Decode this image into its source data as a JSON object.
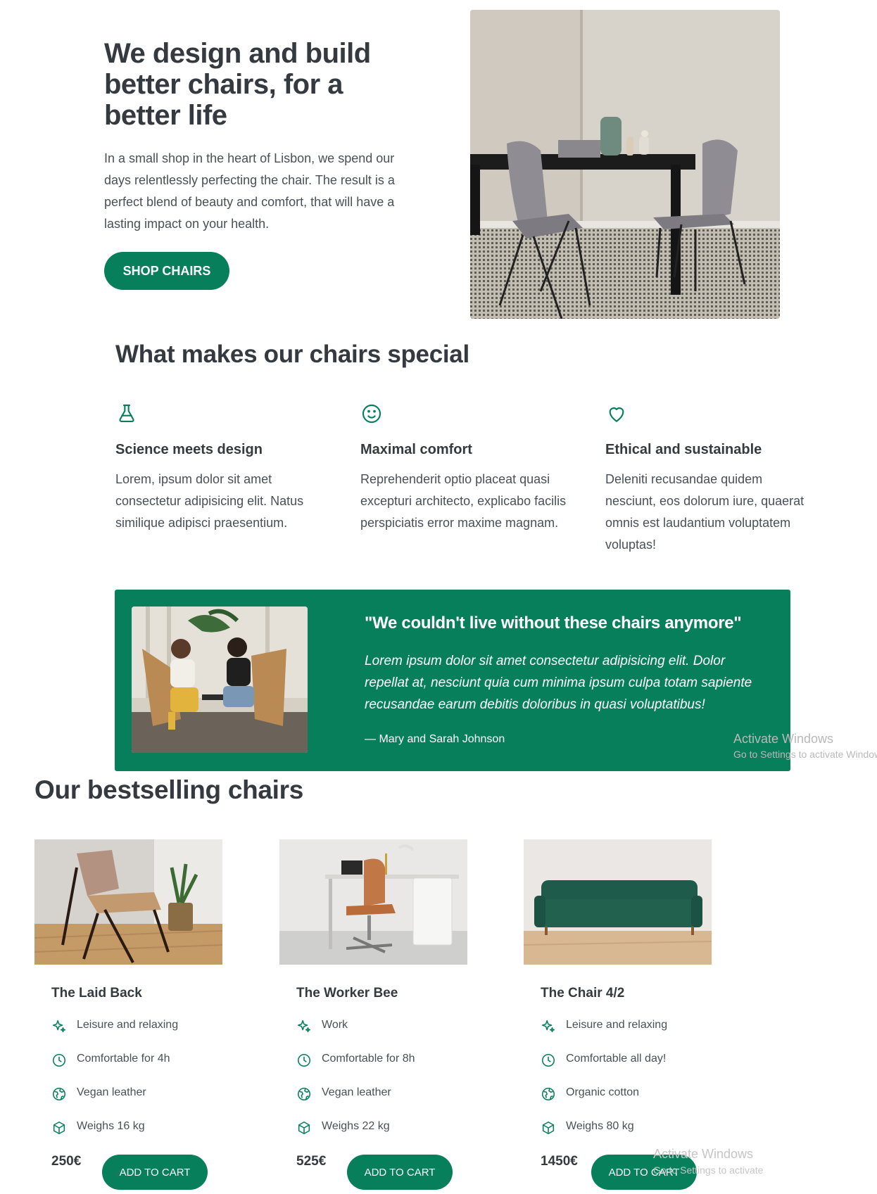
{
  "hero": {
    "title": "We design and build better chairs, for a better life",
    "text": "In a small shop in the heart of Lisbon, we spend our days relentlessly perfecting the chair. The result is a perfect blend of beauty and comfort, that will have a lasting impact on your health.",
    "button": "SHOP CHAIRS"
  },
  "features": {
    "title": "What makes our chairs special",
    "items": [
      {
        "icon": "flask-icon",
        "title": "Science meets design",
        "text": "Lorem, ipsum dolor sit amet consectetur adipisicing elit. Natus similique adipisci praesentium."
      },
      {
        "icon": "smiley-icon",
        "title": "Maximal comfort",
        "text": "Reprehenderit optio placeat quasi excepturi architecto, explicabo facilis perspiciatis error maxime magnam."
      },
      {
        "icon": "heart-icon",
        "title": "Ethical and sustainable",
        "text": "Deleniti recusandae quidem nesciunt, eos dolorum iure, quaerat omnis est laudantium voluptatem voluptas!"
      }
    ]
  },
  "testimonial": {
    "title": "\"We couldn't live without these chairs anymore\"",
    "text": "Lorem ipsum dolor sit amet consectetur adipisicing elit. Dolor repellat at, nesciunt quia cum minima ipsum culpa totam sapiente recusandae earum debitis doloribus in quasi voluptatibus!",
    "author": "— Mary and Sarah Johnson"
  },
  "bestsellers": {
    "title": "Our bestselling chairs",
    "products": [
      {
        "name": "The Laid Back",
        "features": [
          "Leisure and relaxing",
          "Comfortable for 4h",
          "Vegan leather",
          "Weighs 16 kg"
        ],
        "price": "250€",
        "button": "ADD TO CART"
      },
      {
        "name": "The Worker Bee",
        "features": [
          "Work",
          "Comfortable for 8h",
          "Vegan leather",
          "Weighs 22 kg"
        ],
        "price": "525€",
        "button": "ADD TO CART"
      },
      {
        "name": "The Chair 4/2",
        "features": [
          "Leisure and relaxing",
          "Comfortable all day!",
          "Organic cotton",
          "Weighs 80 kg"
        ],
        "price": "1450€",
        "button": "ADD TO CART"
      }
    ],
    "feature_icons": [
      "sparkles-icon",
      "clock-icon",
      "globe-icon",
      "cube-icon"
    ]
  },
  "watermark": {
    "line1": "Activate Windows",
    "line2": "Go to Settings to activate Windows.",
    "line2_short": "Go to Settings to activate"
  },
  "colors": {
    "accent": "#087f5b",
    "text": "#343a40",
    "body": "#495057"
  }
}
